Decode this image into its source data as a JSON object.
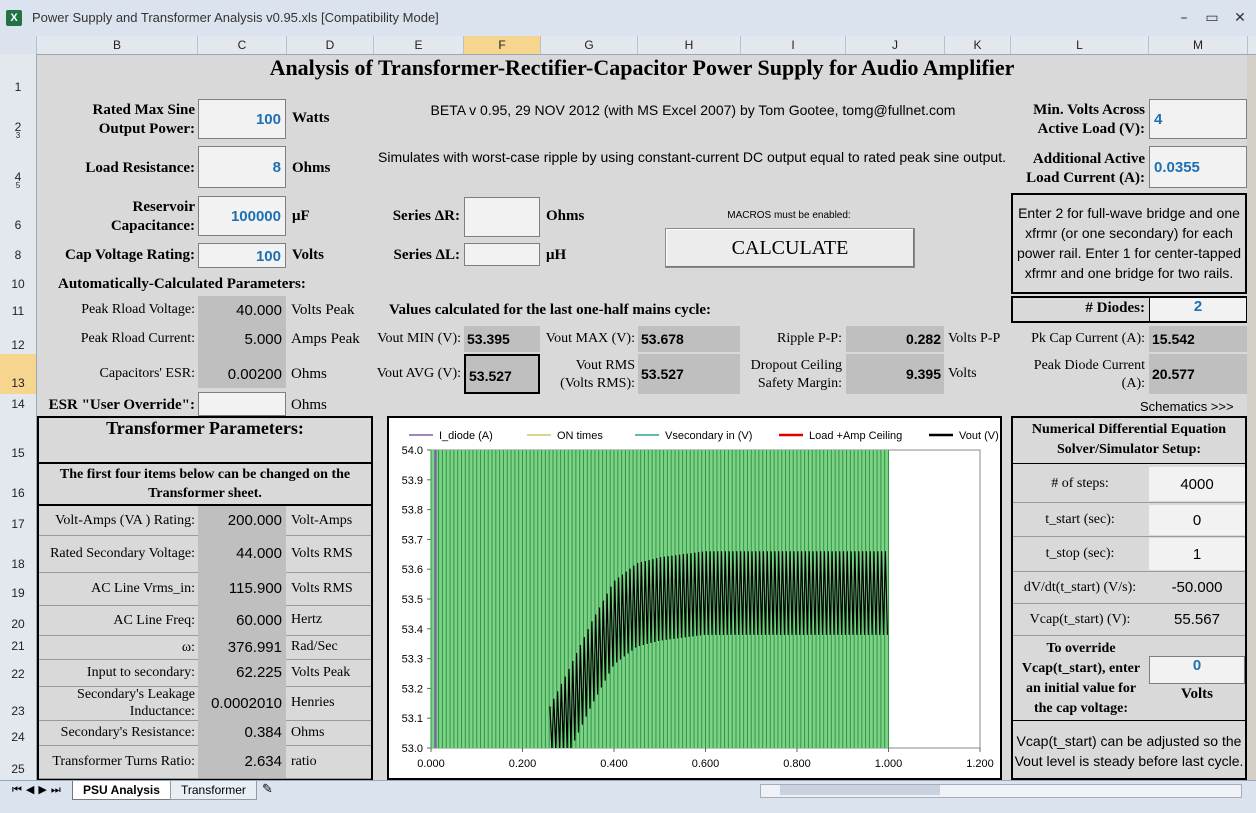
{
  "window": {
    "title": "Power Supply and Transformer Analysis v0.95.xls  [Compatibility Mode]",
    "icon": "excel-icon"
  },
  "columns": [
    "B",
    "C",
    "D",
    "E",
    "F",
    "G",
    "H",
    "I",
    "J",
    "K",
    "L",
    "M"
  ],
  "rows": [
    "1",
    "2",
    "3",
    "4",
    "5",
    "6",
    "8",
    "10",
    "11",
    "12",
    "13",
    "14",
    "15",
    "16",
    "17",
    "18",
    "19",
    "20",
    "21",
    "22",
    "23",
    "24",
    "25"
  ],
  "title": "Analysis of Transformer-Rectifier-Capacitor Power Supply for Audio Amplifier",
  "beta": "BETA v 0.95, 29 NOV 2012 (with MS Excel 2007) by Tom Gootee, tomg@fullnet.com",
  "simulates": "Simulates with worst-case ripple by using constant-current DC output equal to rated peak sine output.",
  "inputs": {
    "power": {
      "label": "Rated Max Sine Output Power:",
      "value": "100",
      "unit": "Watts"
    },
    "load": {
      "label": "Load Resistance:",
      "value": "8",
      "unit": "Ohms"
    },
    "cap": {
      "label": "Reservoir Capacitance:",
      "value": "100000",
      "unit": "μF"
    },
    "capv": {
      "label": "Cap Voltage Rating:",
      "value": "100",
      "unit": "Volts"
    },
    "seriesR": {
      "label": "Series ΔR:",
      "value": "",
      "unit": "Ohms"
    },
    "seriesL": {
      "label": "Series ΔL:",
      "value": "",
      "unit": "μH"
    },
    "minV": {
      "label": "Min. Volts Across Active Load (V):",
      "value": "4"
    },
    "addI": {
      "label": "Additional Active Load Current  (A):",
      "value": "0.0355"
    }
  },
  "macros_note": "MACROS must be enabled:",
  "calc_label": "CALCULATE",
  "diodes_note": "Enter 2 for full-wave bridge and one xfrmr (or one secondary) for each power rail. Enter 1 for center-tapped xfrmr and one bridge for two rails.",
  "diodes": {
    "label": "# Diodes:",
    "value": "2"
  },
  "auto_title": "Automatically-Calculated Parameters:",
  "auto": [
    {
      "label": "Peak Rload Voltage:",
      "value": "40.000",
      "unit": "Volts Peak"
    },
    {
      "label": "Peak Rload Current:",
      "value": "5.000",
      "unit": "Amps Peak"
    },
    {
      "label": "Capacitors' ESR:",
      "value": "0.00200",
      "unit": "Ohms"
    }
  ],
  "esr_override": {
    "label": "ESR \"User Override\":",
    "value": "",
    "unit": "Ohms"
  },
  "values_title": "Values calculated for the last one-half mains cycle:",
  "vout_min": {
    "label": "Vout MIN (V):",
    "value": "53.395"
  },
  "vout_max": {
    "label": "Vout MAX (V):",
    "value": "53.678"
  },
  "ripple": {
    "label": "Ripple P-P:",
    "value": "0.282",
    "unit": "Volts P-P"
  },
  "pkcap": {
    "label": "Pk Cap Current (A):",
    "value": "15.542"
  },
  "vout_avg": {
    "label": "Vout AVG (V):",
    "value": "53.527"
  },
  "vout_rms": {
    "label1": "Vout RMS",
    "label2": "(Volts RMS):",
    "value": "53.527"
  },
  "dropout": {
    "label1": "Dropout Ceiling",
    "label2": "Safety Margin:",
    "value": "9.395",
    "unit": "Volts"
  },
  "pkdiode": {
    "label1": "Peak Diode Current",
    "label2": "(A):",
    "value": "20.577"
  },
  "schematics": "Schematics >>>",
  "xfmr": {
    "title": "Transformer Parameters:",
    "note": "The first four items below can be changed  on the Transformer sheet.",
    "rows": [
      {
        "label": "Volt-Amps (VA ) Rating:",
        "value": "200.000",
        "unit": "Volt-Amps"
      },
      {
        "label": "Rated Secondary Voltage:",
        "value": "44.000",
        "unit": "Volts RMS"
      },
      {
        "label": "AC Line Vrms_in:",
        "value": "115.900",
        "unit": "Volts RMS"
      },
      {
        "label": "AC Line Freq:",
        "value": "60.000",
        "unit": "Hertz"
      },
      {
        "label": "ω:",
        "value": "376.991",
        "unit": "Rad/Sec"
      },
      {
        "label": "Input to secondary:",
        "value": "62.225",
        "unit": "Volts Peak"
      },
      {
        "label": "Secondary's Leakage Inductance:",
        "value": "0.0002010",
        "unit": "Henries"
      },
      {
        "label": "Secondary's Resistance:",
        "value": "0.384",
        "unit": "Ohms"
      },
      {
        "label": "Transformer Turns Ratio:",
        "value": "2.634",
        "unit": "ratio"
      }
    ]
  },
  "solver": {
    "title": "Numerical Differential Equation Solver/Simulator Setup:",
    "rows": [
      {
        "label": "# of steps:",
        "value": "4000"
      },
      {
        "label": "t_start (sec):",
        "value": "0"
      },
      {
        "label": "t_stop (sec):",
        "value": "1"
      },
      {
        "label": "dV/dt(t_start) (V/s):",
        "value": "-50.000"
      },
      {
        "label": "Vcap(t_start) (V):",
        "value": "55.567"
      }
    ],
    "override_label": "To override Vcap(t_start), enter an initial value for the cap voltage:",
    "override_value": "0",
    "override_unit": "Volts",
    "note": "Vcap(t_start) can be adjusted so the Vout level is steady before last cycle."
  },
  "chart_data": {
    "type": "line",
    "title": "",
    "series": [
      {
        "name": "I_diode (A)",
        "color": "#7b5ea7"
      },
      {
        "name": "ON times",
        "color": "#c8c86a"
      },
      {
        "name": "Vsecondary in (V)",
        "color": "#2ca58d"
      },
      {
        "name": "Load +Amp Ceiling",
        "color": "#e00000"
      },
      {
        "name": "Vout (V)",
        "color": "#000000"
      }
    ],
    "xlim": [
      0,
      1.2
    ],
    "ylim": [
      53.0,
      54.0
    ],
    "xticks": [
      "0.000",
      "0.200",
      "0.400",
      "0.600",
      "0.800",
      "1.000",
      "1.200"
    ],
    "yticks": [
      "54.0",
      "53.9",
      "53.8",
      "53.7",
      "53.6",
      "53.5",
      "53.4",
      "53.3",
      "53.2",
      "53.1",
      "53.0"
    ],
    "vout": {
      "x": [
        0.26,
        0.3,
        0.35,
        0.4,
        0.45,
        0.5,
        0.6,
        0.7,
        0.8,
        0.9,
        1.0
      ],
      "avg": [
        53.0,
        53.12,
        53.28,
        53.42,
        53.48,
        53.5,
        53.52,
        53.52,
        53.52,
        53.52,
        53.52
      ],
      "ripple_pp": 0.28
    },
    "on_band": {
      "x_start": 0.0,
      "x_end": 1.0
    },
    "legend": "top"
  },
  "tabs": [
    "PSU Analysis",
    "Transformer"
  ],
  "colors": {
    "input_text": "#1f6fb4",
    "computed_bg": "#bfbfbf",
    "sheet_bg": "#d9d9d9"
  }
}
